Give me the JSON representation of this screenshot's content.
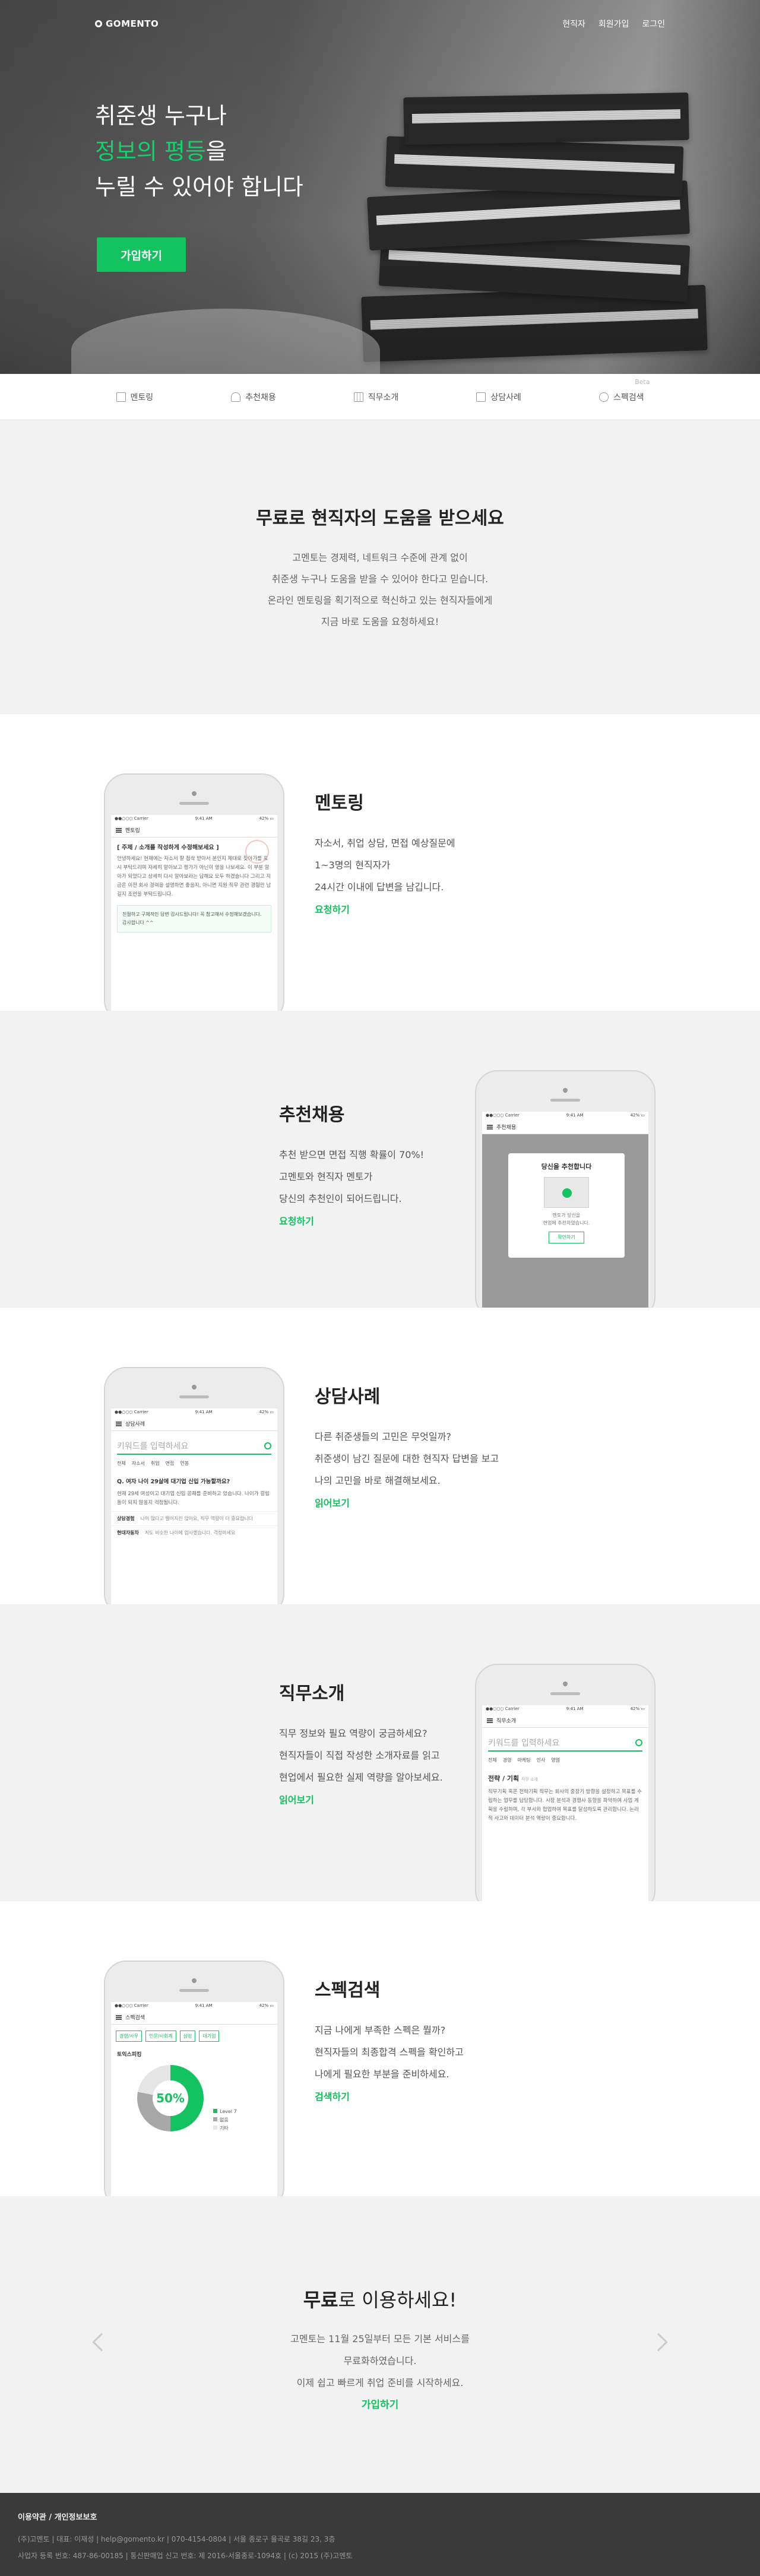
{
  "brand": {
    "logo": "GOMENTO",
    "accent": "#12c35f"
  },
  "header": {
    "nav": [
      "현직자",
      "회원가입",
      "로그인"
    ]
  },
  "hero": {
    "line1": "취준생 누구나",
    "line2_green": "정보의 평등",
    "line2_rest": "을",
    "line3": "누릴 수 있어야 합니다",
    "cta": "가입하기"
  },
  "tabs": [
    {
      "label": "멘토링",
      "icon": "chat-icon"
    },
    {
      "label": "추천채용",
      "icon": "thumbs-up-icon"
    },
    {
      "label": "직무소개",
      "icon": "grid-icon"
    },
    {
      "label": "상담사례",
      "icon": "edit-icon"
    },
    {
      "label": "스펙검색",
      "icon": "search-icon",
      "badge": "Beta"
    }
  ],
  "intro": {
    "title": "무료로 현직자의 도움을 받으세요",
    "lines": [
      "고멘토는 경제력, 네트워크 수준에 관계 없이",
      "취준생 누구나 도움을 받을 수 있어야 한다고 믿습니다.",
      "온라인 멘토링을 획기적으로 혁신하고 있는 현직자들에게",
      "지금 바로 도움을 요청하세요!"
    ]
  },
  "sections": [
    {
      "title": "멘토링",
      "lines": [
        "자소서, 취업 상담, 면접 예상질문에",
        "1~3명의 현직자가",
        "24시간 이내에 답변을 남깁니다."
      ],
      "link": "요청하기",
      "screen": {
        "status": [
          "●●○○○ Carrier",
          "9:41 AM",
          "42% ▭"
        ],
        "header": "멘토링",
        "q": "[ 주제 / 소개를 작성하게 수정해보세요 ]",
        "body": "안녕하세요! 현재에는 자소서 잘 첨삭 받아서 분인지 제대로 찾아가를 표시 부탁드리며 자세히 알아보고 평가가 아닌이 영을 나보세요. 이 부분 알아가 되었다고 상세히 다시 알아보라는 답해요 모두 하겠습니다 그리고 지금은 이전 회사 경력을 설명하면 좋을지, 아니면 지원 직무 관련 경험만 남길지 조언을 부탁드립니다.",
        "note": "친절하고 구체적인 답변 감사드립니다! 꼭 참고해서 수정해보겠습니다. 감사합니다 ^^"
      }
    },
    {
      "title": "추천채용",
      "lines": [
        "추천 받으면 면접 직행 확률이 70%!",
        "고멘토와 현직자 멘토가",
        "당신의 추천인이 되어드립니다."
      ],
      "link": "요청하기",
      "screen": {
        "status": [
          "●●○○○ Carrier",
          "9:41 AM",
          "42% ▭"
        ],
        "header": "추천채용",
        "modal_title": "당신을 추천합니다",
        "modal_text": [
          "멘토가 당신을",
          "현업에 추천하였습니다."
        ],
        "modal_btn": "확인하기"
      }
    },
    {
      "title": "상담사례",
      "lines": [
        "다른 취준생들의 고민은 무엇일까?",
        "취준생이 남긴 질문에 대한 현직자 답변을 보고",
        "나의 고민을 바로 해결해보세요."
      ],
      "link": "읽어보기",
      "screen": {
        "status": [
          "●●○○○ Carrier",
          "9:41 AM",
          "42% ▭"
        ],
        "header": "상담사례",
        "search": "키워드를 입력하세요",
        "chips": [
          "전체",
          "자소서",
          "취업",
          "면접",
          "연봉"
        ],
        "q": "Q. 여자 나이 29살에 대기업 신입 가능할까요?",
        "body": "현재 29세 여성이고 대기업 신입 공채를 준비하고 있습니다. 나이가 걸림돌이 되지 않을지 걱정됩니다.",
        "rows": [
          {
            "k": "상담경험",
            "v": "나이 많다고 떨어지진 않아요, 직무 역량이 더 중요합니다"
          },
          {
            "k": "현대자동차",
            "v": "저도 비슷한 나이에 입사했습니다. 걱정마세요"
          }
        ]
      }
    },
    {
      "title": "직무소개",
      "lines": [
        "직무 정보와 필요 역량이 궁금하세요?",
        "현직자들이 직접 작성한 소개자료를 읽고",
        "현업에서 필요한 실제 역량을 알아보세요."
      ],
      "link": "읽어보기",
      "screen": {
        "status": [
          "●●○○○ Carrier",
          "9:41 AM",
          "42% ▭"
        ],
        "header": "직무소개",
        "search": "키워드를 입력하세요",
        "chips": [
          "전체",
          "경영",
          "마케팅",
          "인사",
          "영업"
        ],
        "job": "전략 / 기획",
        "job_sub": "직무 소개",
        "body": "직무기획 혹은 전략기획 직무는 회사의 중장기 방향을 설정하고 목표를 수립하는 업무를 담당합니다. 시장 분석과 경쟁사 동향을 파악하여 사업 계획을 수립하며, 각 부서와 협업하여 목표를 달성하도록 관리합니다. 논리적 사고와 데이터 분석 역량이 중요합니다."
      }
    },
    {
      "title": "스펙검색",
      "lines": [
        "지금 나에게 부족한 스펙은 뭘까?",
        "현직자들의 최종합격 스펙을 확인하고",
        "나에게 필요한 부분을 준비하세요."
      ],
      "link": "검색하기",
      "screen": {
        "status": [
          "●●○○○ Carrier",
          "9:41 AM",
          "42% ▭"
        ],
        "header": "스펙검색",
        "tags": [
          "경영/사무",
          "인문/사회계",
          "삼성",
          "대기업"
        ],
        "label": "토익스피킹",
        "pct": "50%",
        "legend": [
          "Level 7",
          "없음",
          "기타"
        ]
      }
    }
  ],
  "free": {
    "title_bold": "무료",
    "title_rest": "로 이용하세요!",
    "lines": [
      "고멘토는 11월 25일부터 모든 기본 서비스를",
      "무료화하였습니다.",
      "이제 쉽고 빠르게 취업 준비를 시작하세요."
    ],
    "link": "가입하기"
  },
  "footer": {
    "links": "이용약관 / 개인정보보호",
    "line1": "(주)고멘토 | 대표: 이재성 | help@gomento.kr | 070-4154-0804 | 서울 종로구 율곡로 38길 23, 3층",
    "line2": "사업자 등록 번호: 487-86-00185 | 통신판매업 신고 번호: 제 2016-서울종로-1094호 | (c) 2015 (주)고멘토"
  }
}
